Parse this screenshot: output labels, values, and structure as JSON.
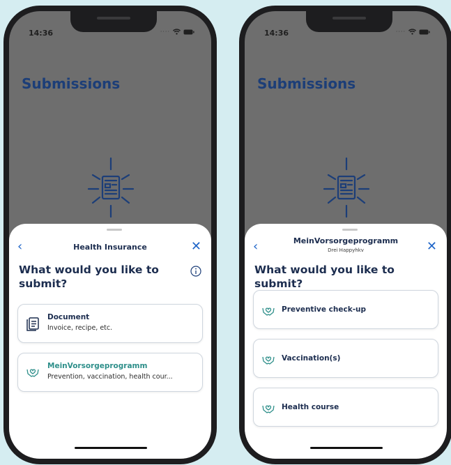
{
  "left_screen": {
    "status_time": "14:36",
    "page_title": "Submissions",
    "sheet": {
      "title": "Health Insurance",
      "question": "What would you like to submit?",
      "options": [
        {
          "title": "Document",
          "subtitle": "Invoice, recipe, etc.",
          "icon": "document-icon"
        },
        {
          "title": "MeinVorsorgeprogramm",
          "subtitle": "Prevention, vaccination, health cour...",
          "icon": "heart-hands-icon"
        }
      ]
    }
  },
  "right_screen": {
    "status_time": "14:36",
    "page_title": "Submissions",
    "sheet": {
      "title": "MeinVorsorgeprogramm",
      "subtitle": "Drei Happyhkv",
      "question": "What would you like to submit?",
      "options": [
        {
          "title": "Preventive check-up",
          "icon": "heart-hands-icon"
        },
        {
          "title": "Vaccination(s)",
          "icon": "heart-hands-icon"
        },
        {
          "title": "Health course",
          "icon": "heart-hands-icon"
        }
      ]
    }
  },
  "colors": {
    "background": "#d5edf1",
    "accent_blue": "#1f65c8",
    "title_navy": "#1c3e78",
    "teal": "#2e8f8a"
  }
}
